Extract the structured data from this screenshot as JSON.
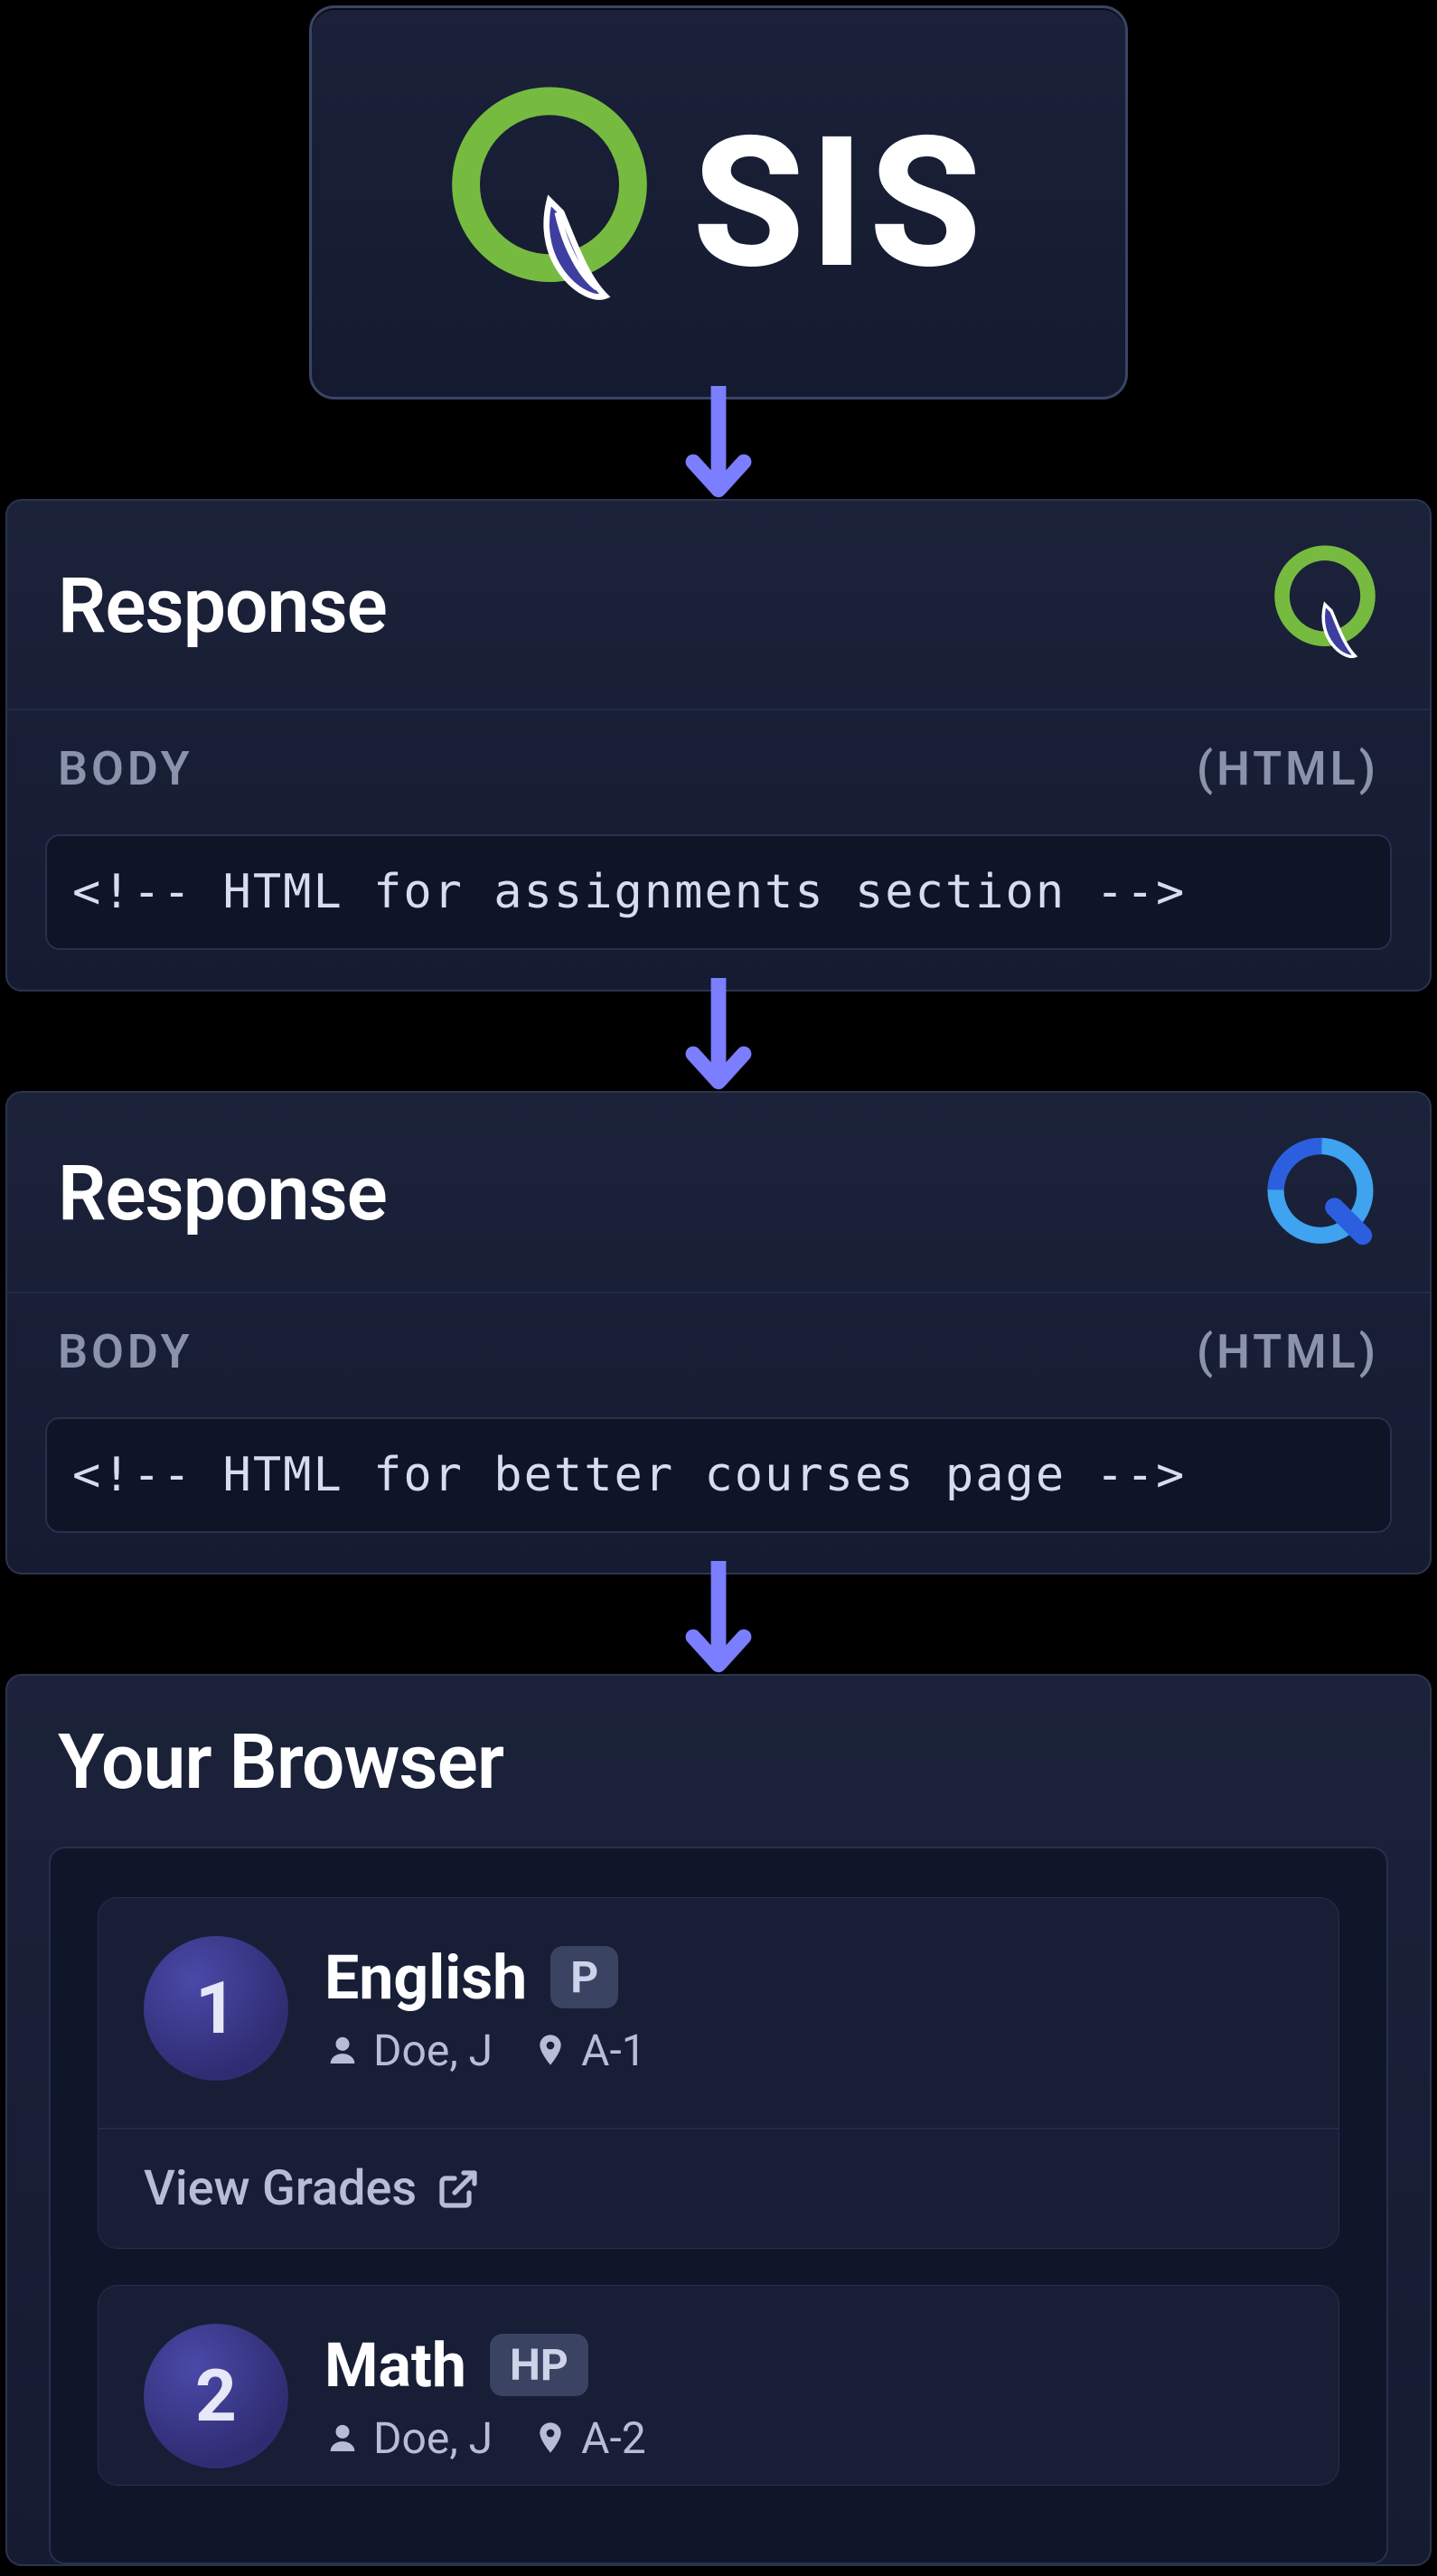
{
  "sis": {
    "label": "SIS"
  },
  "responses": [
    {
      "title": "Response",
      "body_label": "BODY",
      "type_label": "(HTML)",
      "code": "<!-- HTML for assignments section -->",
      "logo": "q-leaf"
    },
    {
      "title": "Response",
      "body_label": "BODY",
      "type_label": "(HTML)",
      "code": "<!-- HTML for better courses page -->",
      "logo": "q-blue"
    }
  ],
  "browser": {
    "title": "Your Browser",
    "action_label": "View Grades",
    "courses": [
      {
        "period": "1",
        "name": "English",
        "tag": "P",
        "teacher": "Doe, J",
        "room": "A-1"
      },
      {
        "period": "2",
        "name": "Math",
        "tag": "HP",
        "teacher": "Doe, J",
        "room": "A-2"
      }
    ]
  }
}
